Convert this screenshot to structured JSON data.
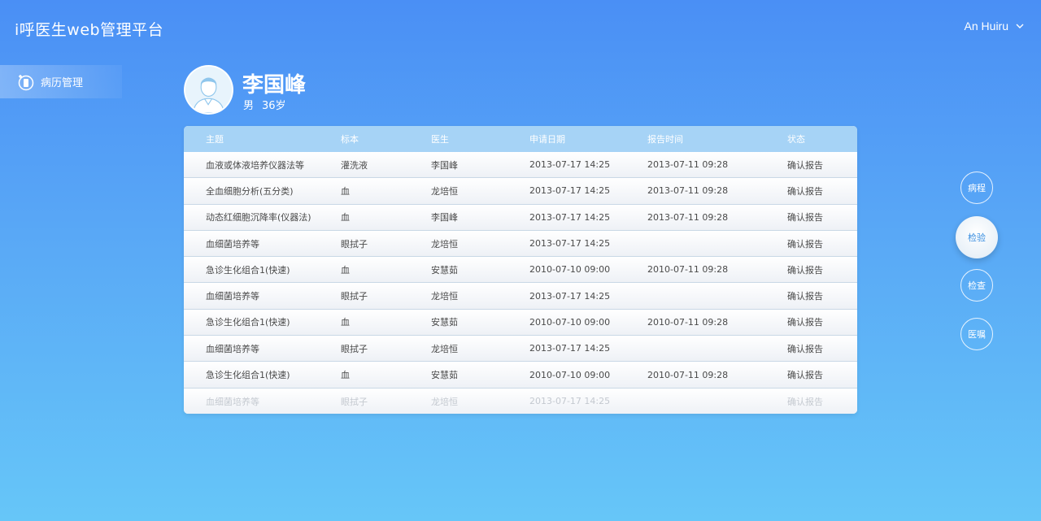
{
  "app": {
    "title": "i呼医生web管理平台"
  },
  "user": {
    "name": "An Huiru"
  },
  "sidebar": {
    "items": [
      {
        "label": "病历管理"
      }
    ]
  },
  "patient": {
    "name": "李国峰",
    "gender": "男",
    "age": "36岁"
  },
  "table": {
    "headers": [
      "主题",
      "标本",
      "医生",
      "申请日期",
      "报告时间",
      "状态"
    ],
    "rows": [
      [
        "血液或体液培养仪器法等",
        "灌洗液",
        "李国峰",
        "2013-07-17    14:25",
        "2013-07-11    09:28",
        "确认报告"
      ],
      [
        "全血细胞分析(五分类)",
        "血",
        "龙培恒",
        "2013-07-17    14:25",
        "2013-07-11    09:28",
        "确认报告"
      ],
      [
        "动态红细胞沉降率(仪器法)",
        "血",
        "李国峰",
        "2013-07-17    14:25",
        "2013-07-11    09:28",
        "确认报告"
      ],
      [
        "血细菌培养等",
        "眼拭子",
        "龙培恒",
        "2013-07-17    14:25",
        "",
        "确认报告"
      ],
      [
        "急诊生化组合1(快速)",
        "血",
        "安慧茹",
        "2010-07-10    09:00",
        "2010-07-11    09:28",
        "确认报告"
      ],
      [
        "血细菌培养等",
        "眼拭子",
        "龙培恒",
        "2013-07-17    14:25",
        "",
        "确认报告"
      ],
      [
        "急诊生化组合1(快速)",
        "血",
        "安慧茹",
        "2010-07-10    09:00",
        "2010-07-11    09:28",
        "确认报告"
      ],
      [
        "血细菌培养等",
        "眼拭子",
        "龙培恒",
        "2013-07-17    14:25",
        "",
        "确认报告"
      ],
      [
        "急诊生化组合1(快速)",
        "血",
        "安慧茹",
        "2010-07-10    09:00",
        "2010-07-11    09:28",
        "确认报告"
      ],
      [
        "血细菌培养等",
        "眼拭子",
        "龙培恒",
        "2013-07-17    14:25",
        "",
        "确认报告"
      ]
    ]
  },
  "side_nav": {
    "items": [
      {
        "label": "病程",
        "active": false
      },
      {
        "label": "检验",
        "active": true
      },
      {
        "label": "检查",
        "active": false
      },
      {
        "label": "医嘱",
        "active": false
      }
    ]
  },
  "colors": {
    "accent": "#3b8fe0",
    "header_row": "#a6d3f6"
  },
  "icons": {
    "sidebar": "medical-record-icon",
    "user_menu": "chevron-down-icon",
    "avatar": "user-avatar-icon"
  }
}
